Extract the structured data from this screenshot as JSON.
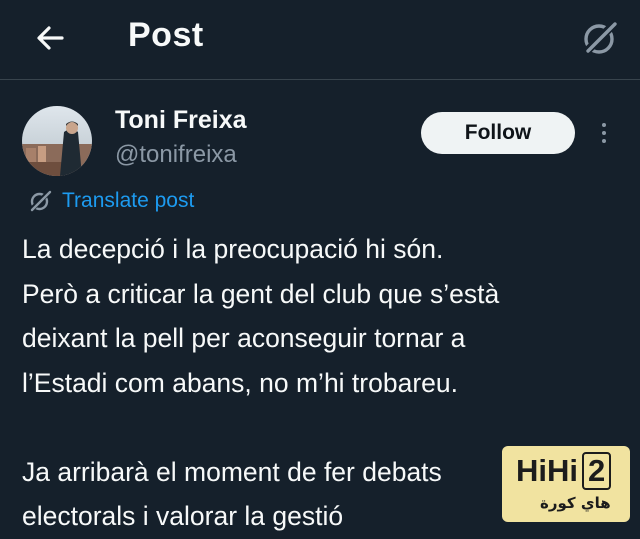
{
  "header": {
    "back_icon": "arrow-left-icon",
    "title": "Post",
    "right_icon": "slashed-x-icon"
  },
  "author": {
    "name": "Toni Freixa",
    "handle": "@tonifreixa",
    "follow_label": "Follow",
    "more_icon": "more-vertical-icon"
  },
  "translate": {
    "icon": "globe-slash-icon",
    "label": "Translate post"
  },
  "post": {
    "lines": [
      "La decepció i la preocupació hi són.",
      "Però a criticar la gent del club que s’està",
      "deixant la pell per aconseguir tornar a",
      "l’Estadi com abans, no m’hi trobareu.",
      "Ja arribarà el moment de fer debats",
      "electorals i valorar la gestió"
    ]
  },
  "watermark": {
    "logo_text_a": "HiHi",
    "logo_text_b": "2",
    "arabic_text": "هاي كورة"
  },
  "colors": {
    "background": "#15202b",
    "text": "#f7f9f9",
    "muted": "#8b98a5",
    "link": "#1d9bf0",
    "follow_bg": "#eff3f4"
  }
}
